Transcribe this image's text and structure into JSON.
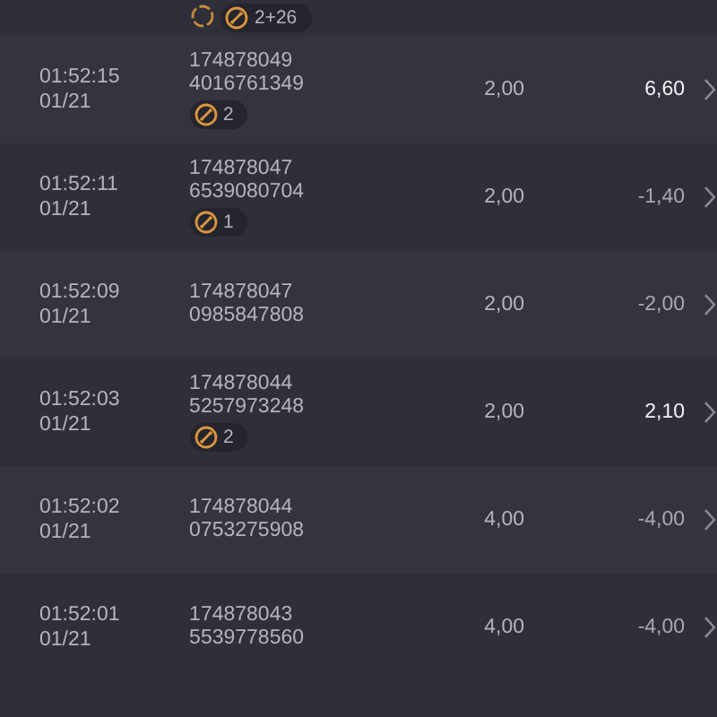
{
  "top_row": {
    "badge": "2+26"
  },
  "rows": [
    {
      "time": "01:52:15",
      "date": "01/21",
      "id_1": "174878049",
      "id_2": "4016761349",
      "badge": "2",
      "stake": "2,00",
      "result": "6,60",
      "kind": "win"
    },
    {
      "time": "01:52:11",
      "date": "01/21",
      "id_1": "174878047",
      "id_2": "6539080704",
      "badge": "1",
      "stake": "2,00",
      "result": "-1,40",
      "kind": "loss"
    },
    {
      "time": "01:52:09",
      "date": "01/21",
      "id_1": "174878047",
      "id_2": "0985847808",
      "stake": "2,00",
      "result": "-2,00",
      "kind": "loss"
    },
    {
      "time": "01:52:03",
      "date": "01/21",
      "id_1": "174878044",
      "id_2": "5257973248",
      "badge": "2",
      "stake": "2,00",
      "result": "2,10",
      "kind": "win"
    },
    {
      "time": "01:52:02",
      "date": "01/21",
      "id_1": "174878044",
      "id_2": "0753275908",
      "stake": "4,00",
      "result": "-4,00",
      "kind": "loss"
    },
    {
      "time": "01:52:01",
      "date": "01/21",
      "id_1": "174878043",
      "id_2": "5539778560",
      "stake": "4,00",
      "result": "-4,00",
      "kind": "loss"
    }
  ]
}
